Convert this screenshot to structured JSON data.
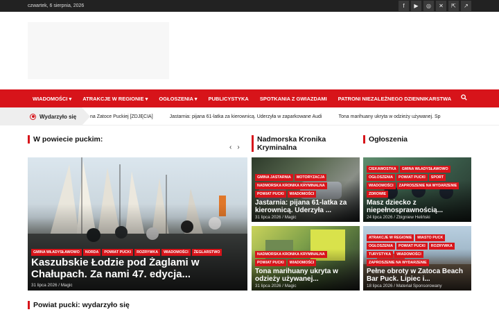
{
  "topbar": {
    "date": "czwartek, 6 sierpnia, 2026",
    "social": [
      {
        "icon": "facebook-icon",
        "glyph": "f"
      },
      {
        "icon": "youtube-icon",
        "glyph": "▶"
      },
      {
        "icon": "instagram-icon",
        "glyph": "◎"
      },
      {
        "icon": "x-icon",
        "glyph": "✕"
      },
      {
        "icon": "external-link-icon",
        "glyph": "⇱"
      },
      {
        "icon": "share-icon",
        "glyph": "↗"
      }
    ]
  },
  "nav": {
    "items": [
      {
        "label": "WIADOMOŚCI",
        "caret": "▾"
      },
      {
        "label": "ATRAKCJE W REGIONIE",
        "caret": "▾"
      },
      {
        "label": "OGŁOSZENIA",
        "caret": "▾"
      },
      {
        "label": "PUBLICYSTYKA",
        "caret": ""
      },
      {
        "label": "SPOTKANIA Z GWIAZDAMI",
        "caret": ""
      },
      {
        "label": "PATRONI NIEZALEŻNEGO DZIENNIKARSTWA",
        "caret": ""
      }
    ],
    "search_icon": "search-icon"
  },
  "ticker": {
    "label": "Wydarzyło się",
    "items": [
      "na Zatoce Puckiej [ZDJĘCIA]",
      "Jastarnia: pijana 61-latka za kierownicą. Uderzyła w zaparkowane Audi",
      "Tona marihuany ukryta w odzieży używanej. Sp"
    ]
  },
  "sections": {
    "left": "W powiecie puckim:",
    "middle": "Nadmorska Kronika Kryminalna",
    "right": "Ogłoszenia",
    "bottom": "Powiat pucki: wydarzyło się"
  },
  "main_card": {
    "tags": [
      "GMINA WŁADYSŁAWOWO",
      "NORDA",
      "POWIAT PUCKI",
      "ROZRYWKA",
      "WIADOMOŚCI",
      "ŻEGLARSTWO"
    ],
    "title": "Kaszubskie Łodzie pod Żaglami w Chałupach. Za nami 47. edycja...",
    "meta": "31 lipca 2026 / Magic"
  },
  "crime_cards": [
    {
      "tags": [
        "GMINA JASTARNIA",
        "MOTORYZACJA",
        "NADMORSKA KRONIKA KRYMINALNA",
        "POWIAT PUCKI",
        "WIADOMOŚCI"
      ],
      "title": "Jastarnia: pijana 61-latka za kierownicą. Uderzyła ...",
      "meta": "31 lipca 2026 / Magic"
    },
    {
      "tags": [
        "NADMORSKA KRONIKA KRYMINALNA",
        "POWIAT PUCKI",
        "WIADOMOŚCI"
      ],
      "title": "Tona marihuany ukryta w odzieży używanej...",
      "meta": "31 lipca 2026 / Magic"
    }
  ],
  "ads_cards": [
    {
      "tags": [
        "CIEKAWOSTKA",
        "GMINA WŁADYSŁAWOWO",
        "OGŁOSZENIA",
        "POWIAT PUCKI",
        "SPORT",
        "WIADOMOŚCI",
        "ZAPROSZENIE NA WYDARZENIE",
        "ZDROWIE"
      ],
      "title": "Masz dziecko z niepełnosprawnością...",
      "meta": "24 lipca 2026 / Zbigniew Heliński"
    },
    {
      "tags": [
        "ATRAKCJE W REGIONIE",
        "MIASTO PUCK",
        "OGŁOSZENIA",
        "POWIAT PUCKI",
        "ROZRYWKA",
        "TURYSTYKA",
        "WIADOMOŚCI",
        "ZAPROSZENIE NA WYDARZENIE"
      ],
      "title": "Pełne obroty w Zatoca Beach Bar Puck. Lipiec i...",
      "meta": "18 lipca 2026 / Materiał Sponsorowany"
    }
  ],
  "colors": {
    "accent": "#d7141a",
    "topbar": "#222222"
  }
}
